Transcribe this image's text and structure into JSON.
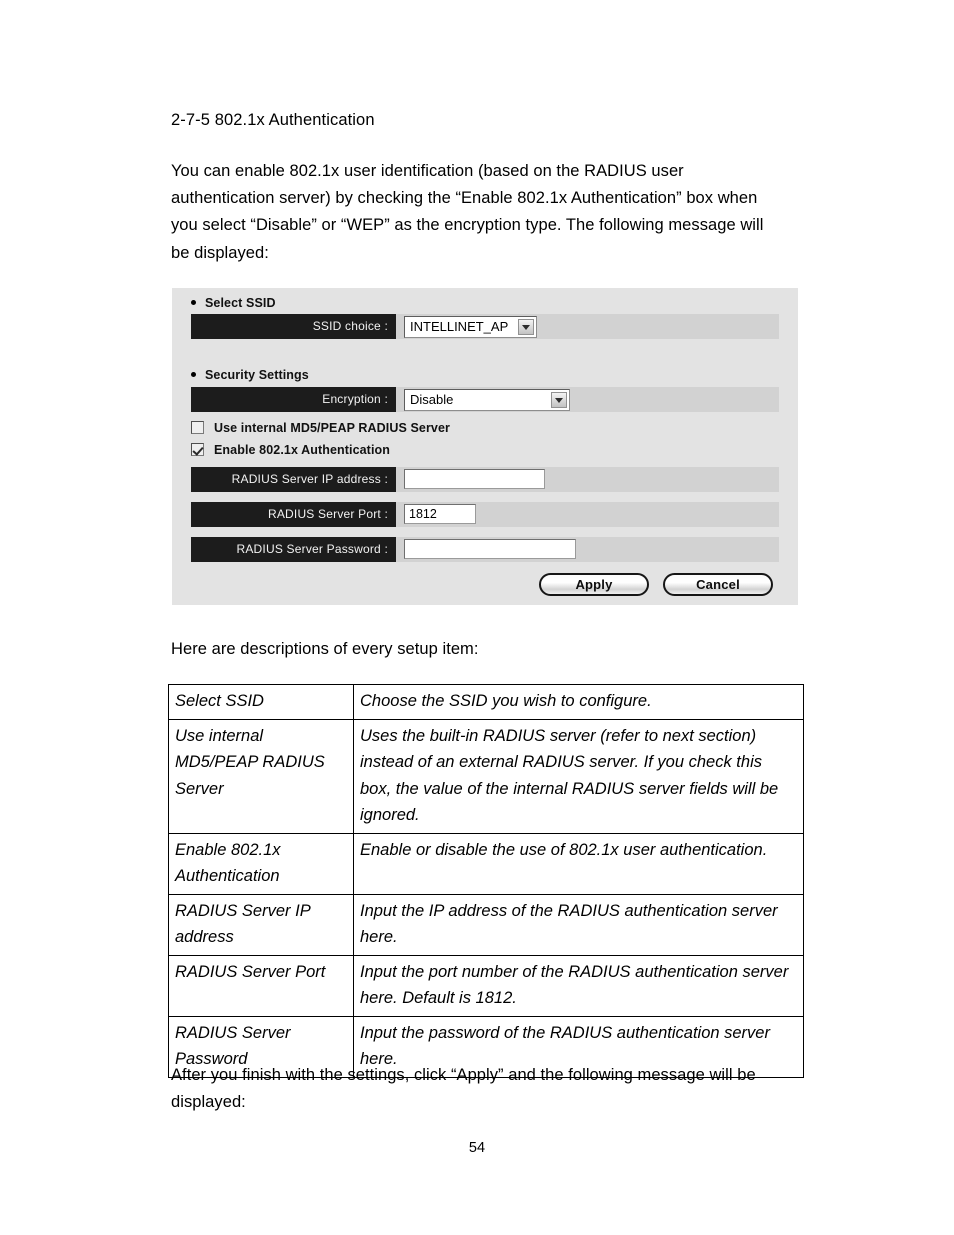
{
  "document": {
    "heading": "2-7-5 802.1x Authentication",
    "intro_paragraph": "You can enable 802.1x user identification (based on the RADIUS user authentication server) by checking the “Enable 802.1x Authentication” box when you select “Disable” or “WEP” as the encryption type. The following message will be displayed:",
    "descriptions_lead": "Here are descriptions of every setup item:",
    "closing_paragraph": "After you finish with the settings, click “Apply” and the following message will be displayed:",
    "page_number": "54"
  },
  "ui_panel": {
    "sections": {
      "select_ssid": "Select SSID",
      "security_settings": "Security Settings"
    },
    "fields": {
      "ssid_choice_label": "SSID choice :",
      "ssid_choice_value": "INTELLINET_AP",
      "encryption_label": "Encryption :",
      "encryption_value": "Disable",
      "radius_ip_label": "RADIUS Server IP address :",
      "radius_ip_value": "",
      "radius_port_label": "RADIUS Server Port :",
      "radius_port_value": "1812",
      "radius_password_label": "RADIUS Server Password :",
      "radius_password_value": ""
    },
    "checkboxes": [
      {
        "label": "Use internal MD5/PEAP RADIUS Server",
        "checked": false
      },
      {
        "label": "Enable 802.1x Authentication",
        "checked": true
      }
    ],
    "buttons": {
      "apply": "Apply",
      "cancel": "Cancel"
    },
    "colors": {
      "panel_background": "#e3e3e3",
      "row_background": "#d2d2d2",
      "label_background": "#1c1c1c",
      "label_text": "#f2f2f2"
    }
  },
  "description_table": {
    "rows": [
      {
        "term": "Select SSID",
        "definition": "Choose the SSID you wish to configure."
      },
      {
        "term": "Use internal MD5/PEAP RADIUS Server",
        "definition": "Uses the built-in RADIUS server (refer to next section) instead of an external RADIUS server. If you check this box, the value of the internal RADIUS server fields will be ignored."
      },
      {
        "term": "Enable 802.1x Authentication",
        "definition": "Enable or disable the use of 802.1x user authentication."
      },
      {
        "term": "RADIUS Server IP address",
        "definition": "Input the IP address of the RADIUS authentication server here."
      },
      {
        "term": "RADIUS Server Port",
        "definition": "Input the port number of the RADIUS authentication server here. Default is 1812."
      },
      {
        "term": "RADIUS Server Password",
        "definition": "Input the password of the RADIUS authentication server here."
      }
    ]
  }
}
